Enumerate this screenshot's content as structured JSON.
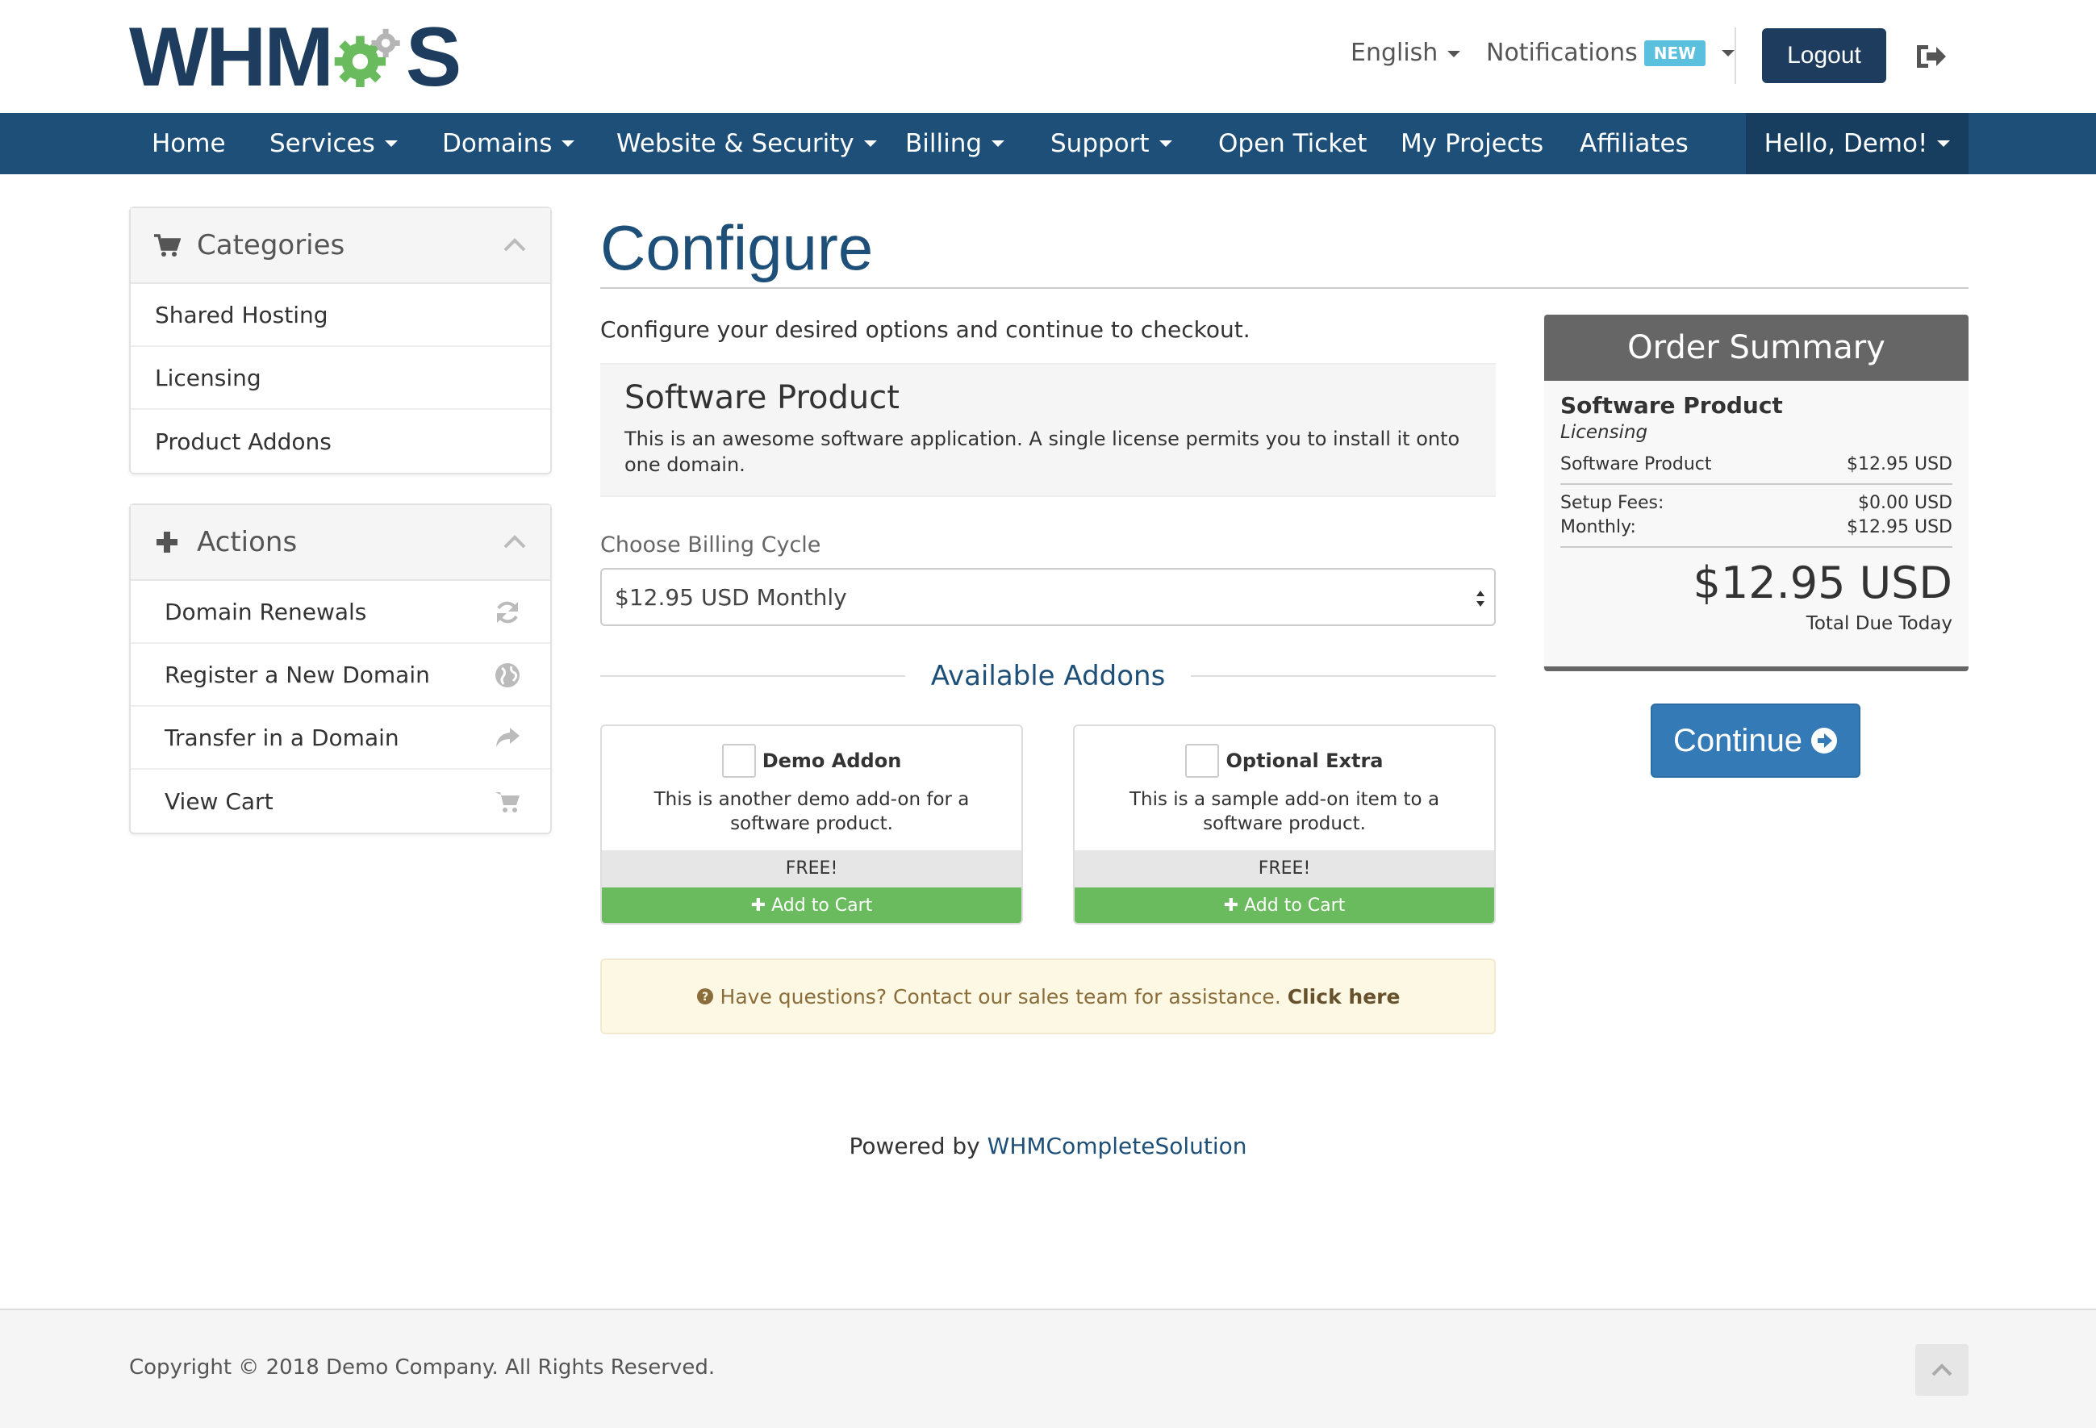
{
  "brand": {
    "logo_text_left": "WHM",
    "logo_text_right": "S",
    "primary_color": "#1d4f78",
    "accent_green": "#6aba5e"
  },
  "header": {
    "language": "English",
    "notifications_label": "Notifications",
    "notifications_badge": "NEW",
    "logout_label": "Logout"
  },
  "nav": {
    "items": [
      {
        "label": "Home"
      },
      {
        "label": "Services"
      },
      {
        "label": "Domains"
      },
      {
        "label": "Website & Security"
      },
      {
        "label": "Billing"
      },
      {
        "label": "Support"
      },
      {
        "label": "Open Ticket"
      },
      {
        "label": "My Projects"
      },
      {
        "label": "Affiliates"
      }
    ],
    "user_greeting": "Hello, Demo!"
  },
  "sidebar": {
    "categories": {
      "title": "Categories",
      "items": [
        {
          "label": "Shared Hosting"
        },
        {
          "label": "Licensing"
        },
        {
          "label": "Product Addons"
        }
      ]
    },
    "actions": {
      "title": "Actions",
      "items": [
        {
          "label": "Domain Renewals",
          "icon": "refresh-icon"
        },
        {
          "label": "Register a New Domain",
          "icon": "globe-icon"
        },
        {
          "label": "Transfer in a Domain",
          "icon": "share-icon"
        },
        {
          "label": "View Cart",
          "icon": "cart-icon"
        }
      ]
    }
  },
  "main": {
    "title": "Configure",
    "intro": "Configure your desired options and continue to checkout.",
    "product": {
      "name": "Software Product",
      "description": "This is an awesome software application. A single license permits you to install it onto one domain."
    },
    "billing": {
      "label": "Choose Billing Cycle",
      "selected": "$12.95 USD Monthly"
    },
    "addons_heading": "Available Addons",
    "addons": [
      {
        "name": "Demo Addon",
        "description": "This is another demo add-on for a software product.",
        "price": "FREE!",
        "add_label": "Add to Cart"
      },
      {
        "name": "Optional Extra",
        "description": "This is a sample add-on item to a software product.",
        "price": "FREE!",
        "add_label": "Add to Cart"
      }
    ],
    "help": {
      "text": "Have questions? Contact our sales team for assistance.",
      "link": "Click here"
    }
  },
  "summary": {
    "title": "Order Summary",
    "product": "Software Product",
    "category": "Licensing",
    "line_label": "Software Product",
    "line_price": "$12.95 USD",
    "setup_label": "Setup Fees:",
    "setup_price": "$0.00 USD",
    "monthly_label": "Monthly:",
    "monthly_price": "$12.95 USD",
    "total": "$12.95 USD",
    "total_label": "Total Due Today",
    "continue_label": "Continue"
  },
  "powered": {
    "prefix": "Powered by",
    "link": "WHMCompleteSolution"
  },
  "footer": {
    "copyright": "Copyright © 2018 Demo Company. All Rights Reserved."
  }
}
